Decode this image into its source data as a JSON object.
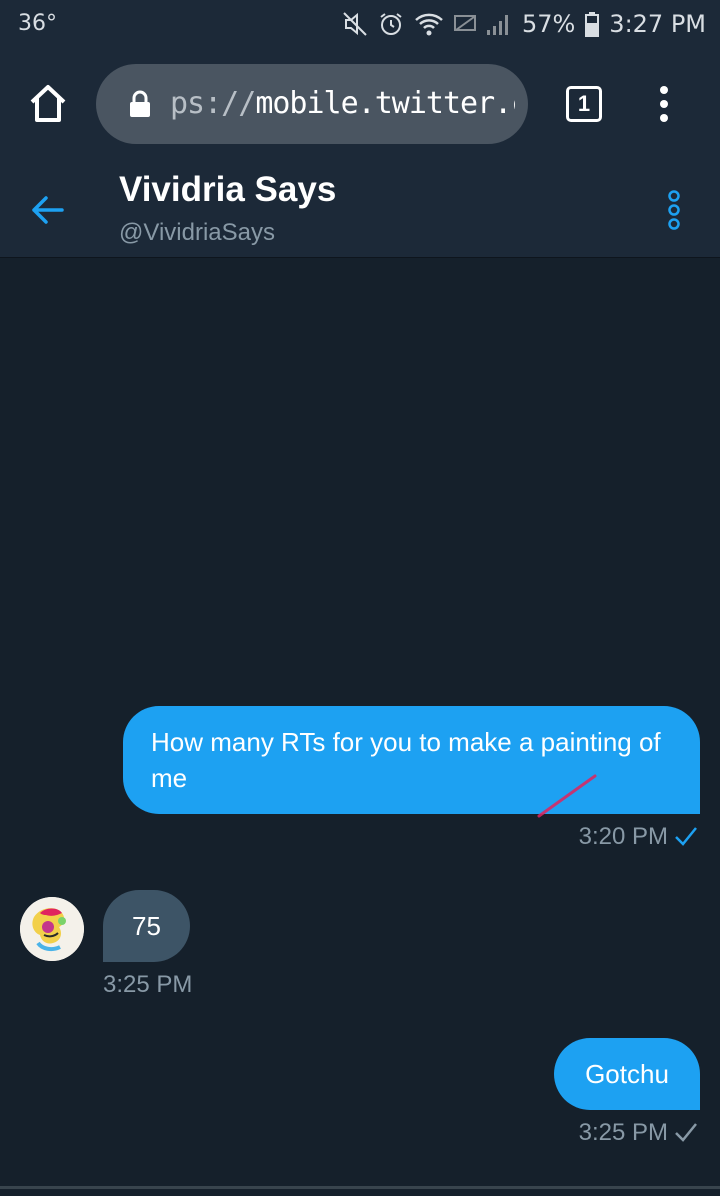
{
  "status_bar": {
    "temperature": "36°",
    "battery": "57%",
    "time": "3:27 PM"
  },
  "browser": {
    "url_prefix": "ps://",
    "url_domain": "mobile.twitter.com",
    "tab_count": "1"
  },
  "conversation": {
    "name": "Vividria Says",
    "handle": "@VividriaSays"
  },
  "messages": [
    {
      "direction": "outgoing",
      "text": "How many RTs for you to make a painting of me",
      "time": "3:20 PM",
      "status": "read"
    },
    {
      "direction": "incoming",
      "text": "75",
      "time": "3:25 PM"
    },
    {
      "direction": "outgoing",
      "text": "Gotchu",
      "time": "3:25 PM",
      "status": "sent"
    }
  ],
  "colors": {
    "background": "#15202b",
    "header": "#1c2938",
    "accent": "#1da1f2",
    "incoming_bubble": "#3d5466",
    "muted_text": "#8899a6"
  }
}
